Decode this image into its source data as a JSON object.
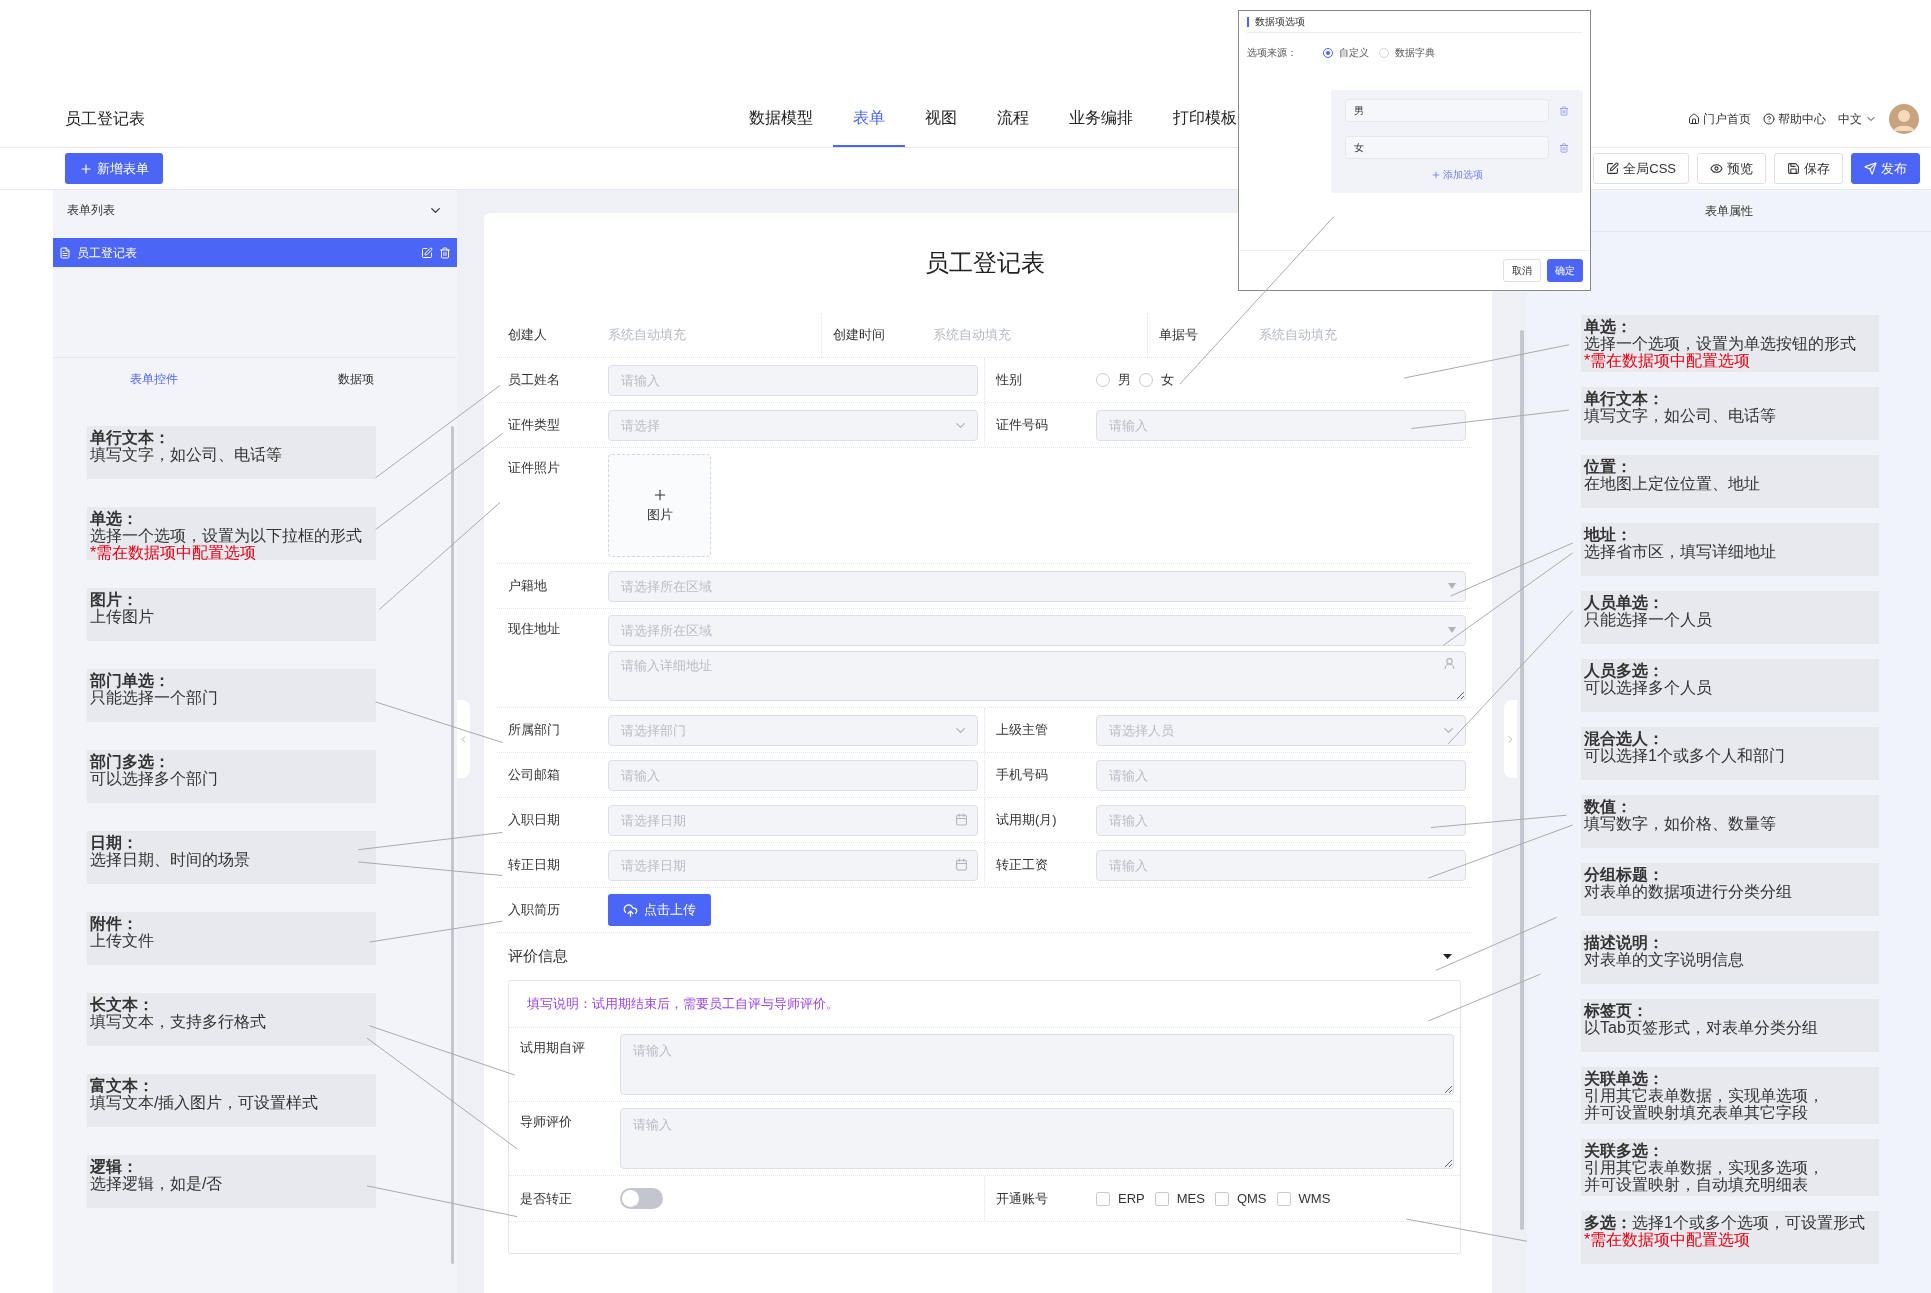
{
  "header": {
    "title": "员工登记表",
    "nav": [
      {
        "label": "数据模型",
        "selected": false
      },
      {
        "label": "表单",
        "selected": true
      },
      {
        "label": "视图",
        "selected": false
      },
      {
        "label": "流程",
        "selected": false
      },
      {
        "label": "业务编排",
        "selected": false
      },
      {
        "label": "打印模板",
        "selected": false
      }
    ],
    "links": [
      {
        "label": "门户首页",
        "kind": "home"
      },
      {
        "label": "帮助中心",
        "kind": "help"
      }
    ],
    "language": "中文"
  },
  "toolbar": {
    "new_button": "新增表单",
    "actions": [
      {
        "label": "全局CSS",
        "kind": "css",
        "primary": false
      },
      {
        "label": "预览",
        "kind": "preview",
        "primary": false
      },
      {
        "label": "保存",
        "kind": "save",
        "primary": false
      },
      {
        "label": "发布",
        "kind": "publish",
        "primary": true
      }
    ]
  },
  "left_panel": {
    "list_title": "表单列表",
    "forms": [
      {
        "label": "员工登记表",
        "selected": true
      }
    ],
    "tabs": [
      {
        "label": "表单控件",
        "selected": true
      },
      {
        "label": "数据项",
        "selected": false
      }
    ],
    "controls": [
      {
        "title": "单行文本：",
        "description": "填写文字，如公司、电话等"
      },
      {
        "title": "单选：",
        "description": "选择一个选项，设置为以下拉框的形式",
        "note": "*需在数据项中配置选项"
      },
      {
        "title": "图片：",
        "description": "上传图片"
      },
      {
        "title": "部门单选：",
        "description": "只能选择一个部门"
      },
      {
        "title": "部门多选：",
        "description": "可以选择多个部门"
      },
      {
        "title": "日期：",
        "description": "选择日期、时间的场景"
      },
      {
        "title": "附件：",
        "description": "上传文件"
      },
      {
        "title": "长文本：",
        "description": "填写文本，支持多行格式"
      },
      {
        "title": "富文本：",
        "description": "填写文本/插入图片，可设置样式"
      },
      {
        "title": "逻辑：",
        "description": "选择逻辑，如是/否"
      }
    ]
  },
  "form": {
    "title": "员工登记表",
    "rows": [
      {
        "cells": [
          {
            "label": "创建人",
            "kind": "auto",
            "value": "系统自动填充"
          },
          {
            "label": "创建时间",
            "kind": "auto",
            "value": "系统自动填充"
          },
          {
            "label": "单据号",
            "kind": "auto",
            "value": "系统自动填充"
          }
        ]
      },
      {
        "cells": [
          {
            "label": "员工姓名",
            "kind": "input",
            "placeholder": "请输入"
          },
          {
            "label": "性别",
            "kind": "radio",
            "options": [
              {
                "label": "男",
                "selected": false
              },
              {
                "label": "女",
                "selected": false
              }
            ]
          }
        ]
      },
      {
        "cells": [
          {
            "label": "证件类型",
            "kind": "select",
            "placeholder": "请选择"
          },
          {
            "label": "证件号码",
            "kind": "input",
            "placeholder": "请输入"
          }
        ]
      },
      {
        "cells": [
          {
            "label": "证件照片",
            "kind": "image",
            "button": "图片"
          }
        ]
      },
      {
        "cells": [
          {
            "label": "户籍地",
            "kind": "region",
            "placeholder": "请选择所在区域"
          }
        ]
      },
      {
        "cells": [
          {
            "label": "现住地址",
            "kind": "address",
            "placeholder": "请选择所在区域",
            "detail_placeholder": "请输入详细地址"
          }
        ]
      },
      {
        "cells": [
          {
            "label": "所属部门",
            "kind": "select",
            "placeholder": "请选择部门"
          },
          {
            "label": "上级主管",
            "kind": "person",
            "placeholder": "请选择人员"
          }
        ]
      },
      {
        "cells": [
          {
            "label": "公司邮箱",
            "kind": "input",
            "placeholder": "请输入"
          },
          {
            "label": "手机号码",
            "kind": "input",
            "placeholder": "请输入"
          }
        ]
      },
      {
        "cells": [
          {
            "label": "入职日期",
            "kind": "date",
            "placeholder": "请选择日期"
          },
          {
            "label": "试用期(月)",
            "kind": "input",
            "placeholder": "请输入"
          }
        ]
      },
      {
        "cells": [
          {
            "label": "转正日期",
            "kind": "date",
            "placeholder": "请选择日期"
          },
          {
            "label": "转正工资",
            "kind": "input",
            "placeholder": "请输入"
          }
        ]
      },
      {
        "cells": [
          {
            "label": "入职简历",
            "kind": "upload",
            "button": "点击上传"
          }
        ]
      }
    ],
    "group": {
      "title": "评价信息",
      "expanded": true,
      "description": "填写说明：试用期结束后，需要员工自评与导师评价。",
      "rows": [
        {
          "cells": [
            {
              "label": "试用期自评",
              "kind": "textarea",
              "placeholder": "请输入"
            }
          ]
        },
        {
          "cells": [
            {
              "label": "导师评价",
              "kind": "textarea",
              "placeholder": "请输入"
            }
          ]
        },
        {
          "cells": [
            {
              "label": "是否转正",
              "kind": "switch",
              "on": false
            },
            {
              "label": "开通账号",
              "kind": "checkboxes",
              "options": [
                {
                  "label": "ERP",
                  "checked": false
                },
                {
                  "label": "MES",
                  "checked": false
                },
                {
                  "label": "QMS",
                  "checked": false
                },
                {
                  "label": "WMS",
                  "checked": false
                }
              ]
            }
          ]
        }
      ]
    }
  },
  "right_panel": {
    "title": "表单属性",
    "controls": [
      {
        "title": "单选：",
        "description": "选择一个选项，设置为单选按钮的形式",
        "note": "*需在数据项中配置选项"
      },
      {
        "title": "单行文本：",
        "description": "填写文字，如公司、电话等"
      },
      {
        "title": "位置：",
        "description": "在地图上定位位置、地址"
      },
      {
        "title": "地址：",
        "description": "选择省市区，填写详细地址"
      },
      {
        "title": "人员单选：",
        "description": "只能选择一个人员"
      },
      {
        "title": "人员多选：",
        "description": "可以选择多个人员"
      },
      {
        "title": "混合选人：",
        "description": "可以选择1个或多个人和部门"
      },
      {
        "title": "数值：",
        "description": "填写数字，如价格、数量等"
      },
      {
        "title": "分组标题：",
        "description": "对表单的数据项进行分类分组"
      },
      {
        "title": "描述说明：",
        "description": "对表单的文字说明信息"
      },
      {
        "title": "标签页：",
        "description": "以Tab页签形式，对表单分类分组"
      },
      {
        "title": "关联单选：",
        "description": [
          "引用其它表单数据，实现单选项，",
          "并可设置映射填充表单其它字段"
        ]
      },
      {
        "title": "关联多选：",
        "description": [
          "引用其它表单数据，实现多选项，",
          "并可设置映射，自动填充明细表"
        ]
      },
      {
        "title": "多选：",
        "description": "选择1个或多个选项，可设置形式",
        "note": "*需在数据项中配置选项",
        "inline": true
      }
    ]
  },
  "dialog": {
    "title": "数据项选项",
    "source_label": "选项来源：",
    "sources": [
      {
        "label": "自定义",
        "selected": true
      },
      {
        "label": "数据字典",
        "selected": false
      }
    ],
    "options": [
      "男",
      "女"
    ],
    "add_option": "添加选项",
    "cancel": "取消",
    "confirm": "确定"
  }
}
